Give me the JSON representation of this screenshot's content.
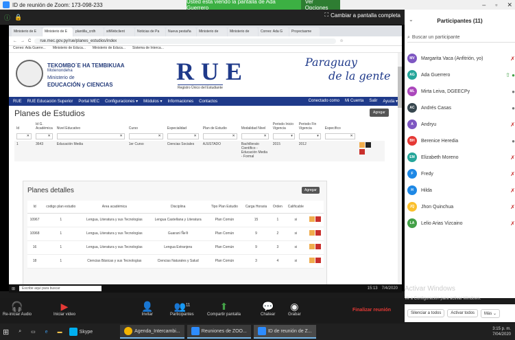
{
  "zoom_window": {
    "title": "ID de reunión de Zoom: 173-098-233",
    "banner": "Usted está viendo la pantalla de Ada Guerrero",
    "view_options": "Ver Opciones",
    "fullscreen": "Cambiar a pantalla completa"
  },
  "browser": {
    "tabs": [
      "Ministerio de E",
      "Ministerio de E",
      "plantilla_crdh",
      "sitWebclient",
      "Noticias de Pa",
      "Nueva pestaña",
      "Ministerio de",
      "Ministerio de",
      "Correo: Ada G",
      "Proyectasme"
    ],
    "url": "rue.mec.gov.py/rue/planes_estudios/index",
    "bookmarks": [
      "Correo: Ada Guerre...",
      "Ministerio de Educa...",
      "Ministerio de Educa...",
      "Sistema de Interca..."
    ]
  },
  "site": {
    "gov_name": "TEKOMBO´E HA TEMBIKUAA",
    "gov_sub": "Motenondeha",
    "ministry1": "Ministerio de",
    "ministry2": "EDUCACIÓN y CIENCIAS",
    "logo": "RUE",
    "logo_sub": "Registro Único del Estudiante",
    "py_logo1": "Paraguay",
    "py_logo2": "de la gente",
    "nav": [
      "RUE",
      "RUE Educación Superior",
      "Portal MEC",
      "Configuraciones ▾",
      "Módulos ▾",
      "Informaciones",
      "Contactos"
    ],
    "nav_right": [
      "Conectado como",
      "Mi Cuenta",
      "Salir",
      "Ayuda ▾"
    ]
  },
  "planes_estudios": {
    "title": "Planes de Estudios",
    "add": "Agregar",
    "headers": [
      "Id",
      "Id G. Académica",
      "Nivel Educativo",
      "Curso",
      "Especialidad",
      "Plan de Estudio",
      "Modalidad Nivel",
      "Periodo Inicio Vigencia",
      "Periodo Fin Vigencia",
      "Específico"
    ],
    "row": [
      "1",
      "3643",
      "Educación Media",
      "1er Curso",
      "Ciencias Sociales",
      "AJUSTADO",
      "Bachillerato Científico - Educación Media - Formal",
      "2015",
      "2012",
      ""
    ]
  },
  "planes_detalles": {
    "title": "Planes detalles",
    "add": "Agregar",
    "headers": [
      "Id",
      "codigo plan estudio",
      "Area académica",
      "Disciplina",
      "Tipo Plan Estudio",
      "Carga Horaria",
      "Orden",
      "Calificable"
    ],
    "rows": [
      [
        "10967",
        "1",
        "Lengua, Literatura y sus Tecnologías",
        "Lengua Castellana y Literatura",
        "Plan Común",
        "15",
        "1",
        "si"
      ],
      [
        "10968",
        "1",
        "Lengua, Literatura y sus Tecnologías",
        "Guaraní Ñe'ẽ",
        "Plan Común",
        "9",
        "2",
        "si"
      ],
      [
        "16",
        "1",
        "Lengua, Literatura y sus Tecnologías",
        "Lengua Extranjera",
        "Plan Común",
        "9",
        "3",
        "si"
      ],
      [
        "18",
        "1",
        "Ciencias Básicas y sus Tecnologías",
        "Ciencias Naturales y Salud",
        "Plan Común",
        "3",
        "4",
        "si"
      ]
    ]
  },
  "inner_taskbar": {
    "search": "Escribe aquí para buscar",
    "time": "15:13",
    "date": "7/4/2020"
  },
  "participants": {
    "title": "Participantes (11)",
    "search_placeholder": "Buscar un participante",
    "list": [
      {
        "initials": "MV",
        "name": "Margarita Vaca (Anfitrión, yo)",
        "color": "#7e57c2"
      },
      {
        "initials": "AG",
        "name": "Ada Guerrero",
        "color": "#26a69a"
      },
      {
        "initials": "ML",
        "name": "Mirta Leiva, DGEECPy",
        "color": "#ab47bc"
      },
      {
        "initials": "AC",
        "name": "Andrés Casas",
        "color": "#37474f"
      },
      {
        "initials": "A",
        "name": "Andryu",
        "color": "#7e57c2"
      },
      {
        "initials": "BH",
        "name": "Berenice Heredia",
        "color": "#e53935"
      },
      {
        "initials": "EM",
        "name": "Elizabeth Moreno",
        "color": "#26a69a"
      },
      {
        "initials": "F",
        "name": "Fredy",
        "color": "#1e88e5"
      },
      {
        "initials": "H",
        "name": "Hilda",
        "color": "#1e88e5"
      },
      {
        "initials": "JQ",
        "name": "Jhon Quinchua",
        "color": "#fbc02d"
      },
      {
        "initials": "LA",
        "name": "Lelio Arias Vizcaino",
        "color": "#43a047"
      }
    ],
    "mute_all": "Silenciar a todos",
    "unmute_all": "Activar todos",
    "more": "Más ⌄"
  },
  "watermark": {
    "line1": "Activar Windows",
    "line2": "Ve a Configuración para activar Windows."
  },
  "toolbar": {
    "audio": "Re-iniciar Audio",
    "video": "Iniciar video",
    "invite": "Invitar",
    "participants": "Participantes",
    "participants_count": "11",
    "share": "Compartir pantalla",
    "chat": "Chatear",
    "record": "Grabar",
    "end": "Finalizar reunión"
  },
  "taskbar": {
    "apps": [
      "Skype",
      "Agenda_Intercambi...",
      "Reuniones de ZOO...",
      "ID de reunión de Z..."
    ],
    "time": "3:15 p. m.",
    "date": "7/04/2020"
  }
}
